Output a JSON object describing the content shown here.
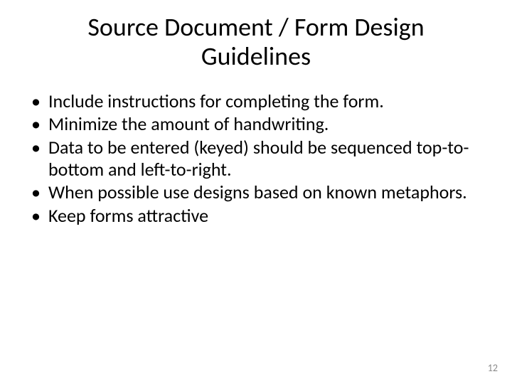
{
  "title_line1": "Source Document / Form Design",
  "title_line2": "Guidelines",
  "bullets": [
    "Include instructions for completing the form.",
    "Minimize the amount of handwriting.",
    "Data to be entered (keyed) should be sequenced top-to-bottom and left-to-right.",
    "When possible use designs based on known metaphors.",
    "Keep forms attractive"
  ],
  "page_number": "12"
}
